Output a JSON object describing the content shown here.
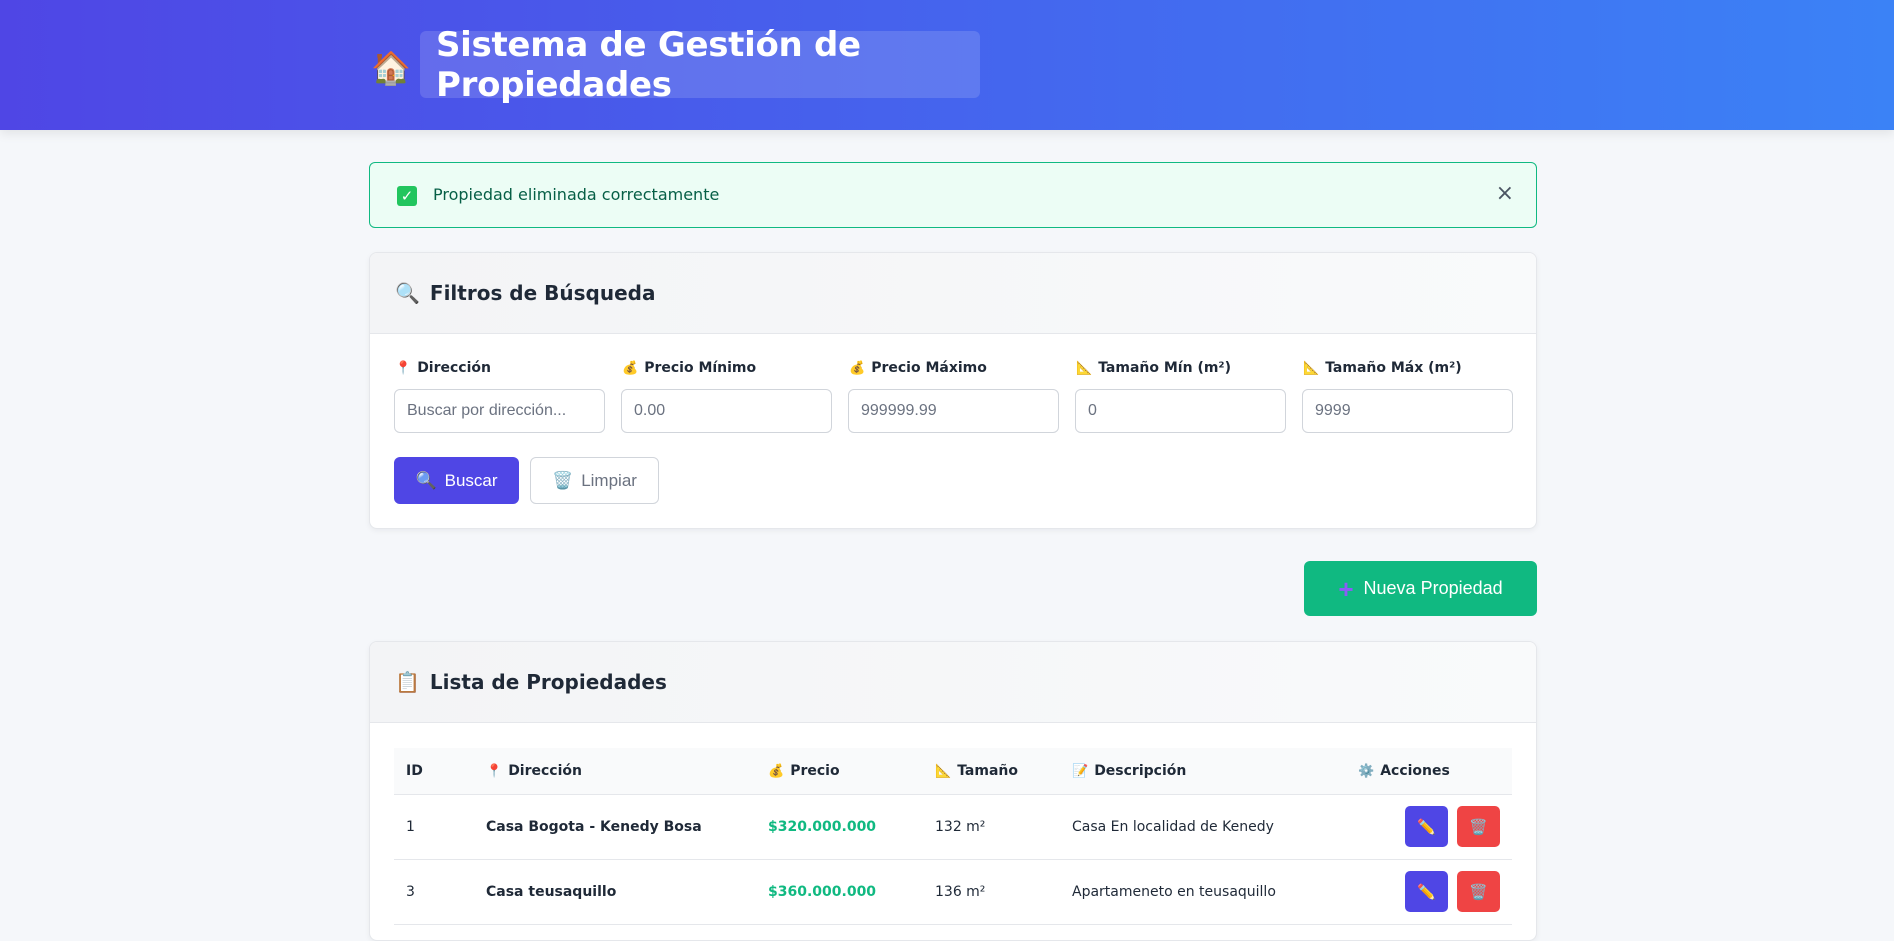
{
  "header": {
    "icon": "house-icon",
    "title": "Sistema de Gestión de Propiedades"
  },
  "alert": {
    "icon": "check-icon",
    "message": "Propiedad eliminada correctamente",
    "close": "×"
  },
  "filters": {
    "title": "Filtros de Búsqueda",
    "fields": [
      {
        "label": "Dirección",
        "placeholder": "Buscar por dirección...",
        "icon": "pin-icon"
      },
      {
        "label": "Precio Mínimo",
        "placeholder": "0.00",
        "icon": "money-bag-icon"
      },
      {
        "label": "Precio Máximo",
        "placeholder": "999999.99",
        "icon": "money-bag-icon"
      },
      {
        "label": "Tamaño Mín (m²)",
        "placeholder": "0",
        "icon": "ruler-icon"
      },
      {
        "label": "Tamaño Máx (m²)",
        "placeholder": "9999",
        "icon": "ruler-icon"
      }
    ],
    "search_label": "Buscar",
    "clear_label": "Limpiar"
  },
  "new_button": "Nueva Propiedad",
  "list": {
    "title": "Lista de Propiedades",
    "columns": [
      "ID",
      "Dirección",
      "Precio",
      "Tamaño",
      "Descripción",
      "Acciones"
    ],
    "rows": [
      {
        "id": "1",
        "address": "Casa Bogota - Kenedy Bosa",
        "price": "$320.000.000",
        "size": "132 m²",
        "description": "Casa En localidad de Kenedy"
      },
      {
        "id": "3",
        "address": "Casa teusaquillo",
        "price": "$360.000.000",
        "size": "136 m²",
        "description": "Apartameneto en teusaquillo"
      }
    ]
  },
  "colors": {
    "header_gradient_start": "#4f46e5",
    "header_gradient_end": "#3b82f6",
    "primary": "#4f46e5",
    "success": "#10b981",
    "danger": "#ef4444"
  }
}
